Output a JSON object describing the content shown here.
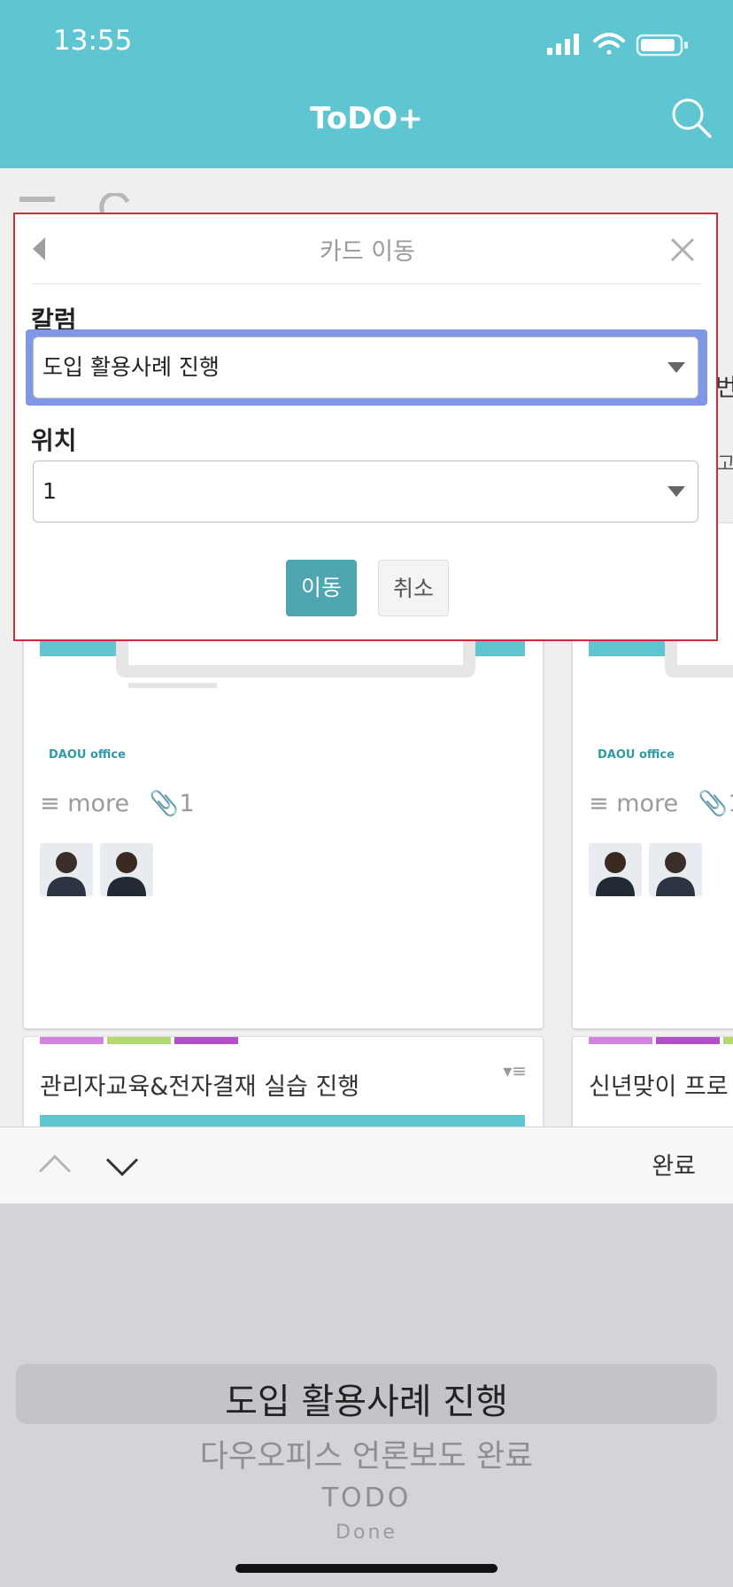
{
  "status_bar": {
    "time": "13:55"
  },
  "app": {
    "title": "ToDO+"
  },
  "dialog": {
    "title": "카드 이동",
    "column_label": "칼럼",
    "column_value": "도입 활용사례 진행",
    "position_label": "위치",
    "position_value": "1",
    "move_button": "이동",
    "cancel_button": "취소"
  },
  "board": {
    "cards": [
      {
        "logo": "DAOU office",
        "more": "more",
        "attachments": "1",
        "title": "관리자교육&전자결재 실습 진행"
      },
      {
        "logo": "DAOU office",
        "more": "more",
        "attachments": "1",
        "title": "신년맞이 프로"
      }
    ],
    "peek_text_1": "번",
    "peek_text_2": "고"
  },
  "picker": {
    "done_label": "완료",
    "options": [
      "도입 활용사례 진행",
      "다우오피스 언론보도 완료",
      "TODO",
      "Done"
    ],
    "selected": "도입 활용사례 진행"
  },
  "colors": {
    "header": "#5fc6d1",
    "accent": "#4fa6b0",
    "dialog_border": "#cc2b3b"
  }
}
